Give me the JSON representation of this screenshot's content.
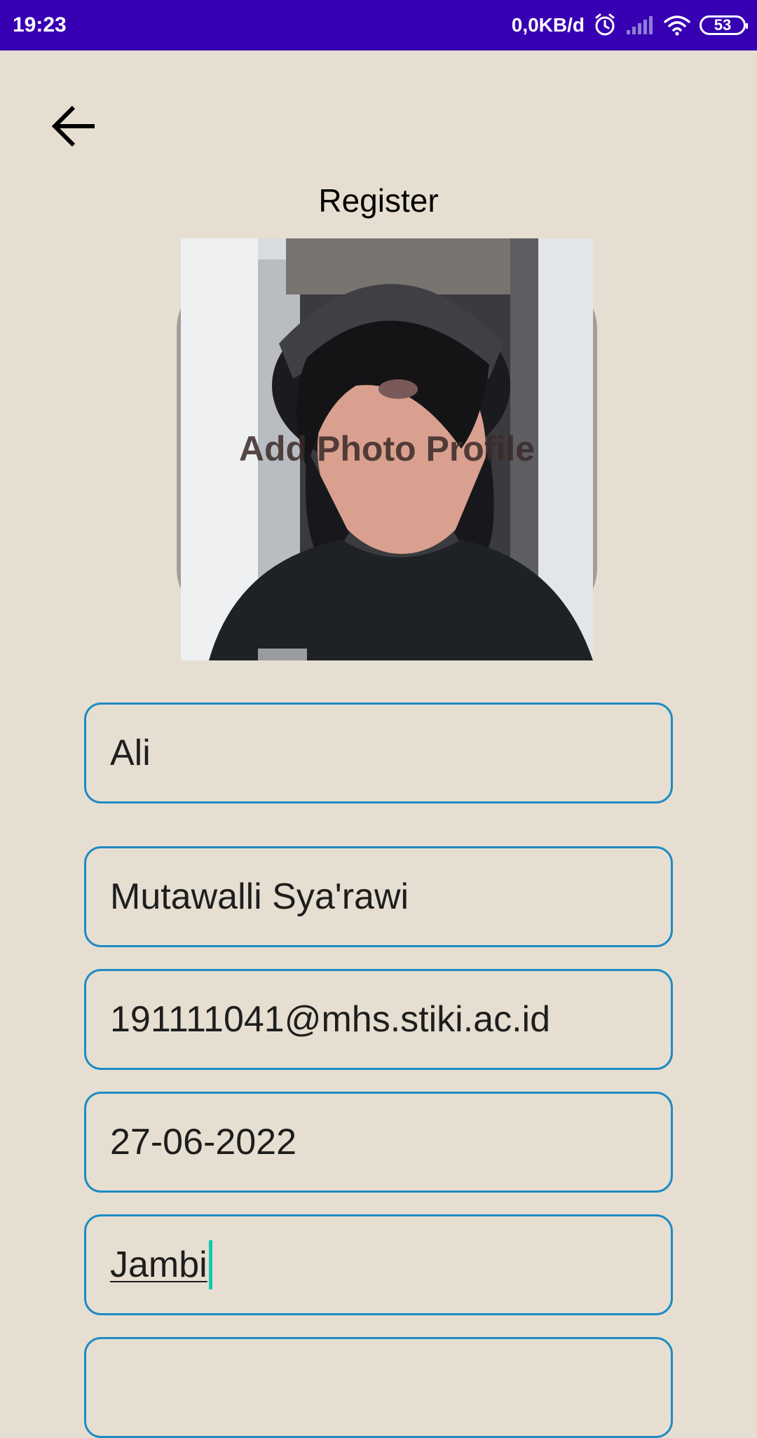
{
  "status_bar": {
    "time": "19:23",
    "net_speed": "0,0KB/d",
    "battery": "53",
    "icons": [
      "alarm-icon",
      "signal-icon",
      "wifi-icon",
      "battery-icon"
    ]
  },
  "header": {
    "back_icon": "arrow-left-icon",
    "title": "Register"
  },
  "photo": {
    "label": "Add Photo Profile"
  },
  "form": {
    "first_name": "Ali",
    "last_name": "Mutawalli Sya'rawi",
    "email": "191111041@mhs.stiki.ac.id",
    "date": "27-06-2022",
    "city": "Jambi"
  },
  "colors": {
    "status_bar": "#3700b3",
    "background": "#e6dfd1",
    "field_border": "#1f8ac4",
    "caret": "#13c8b0"
  }
}
